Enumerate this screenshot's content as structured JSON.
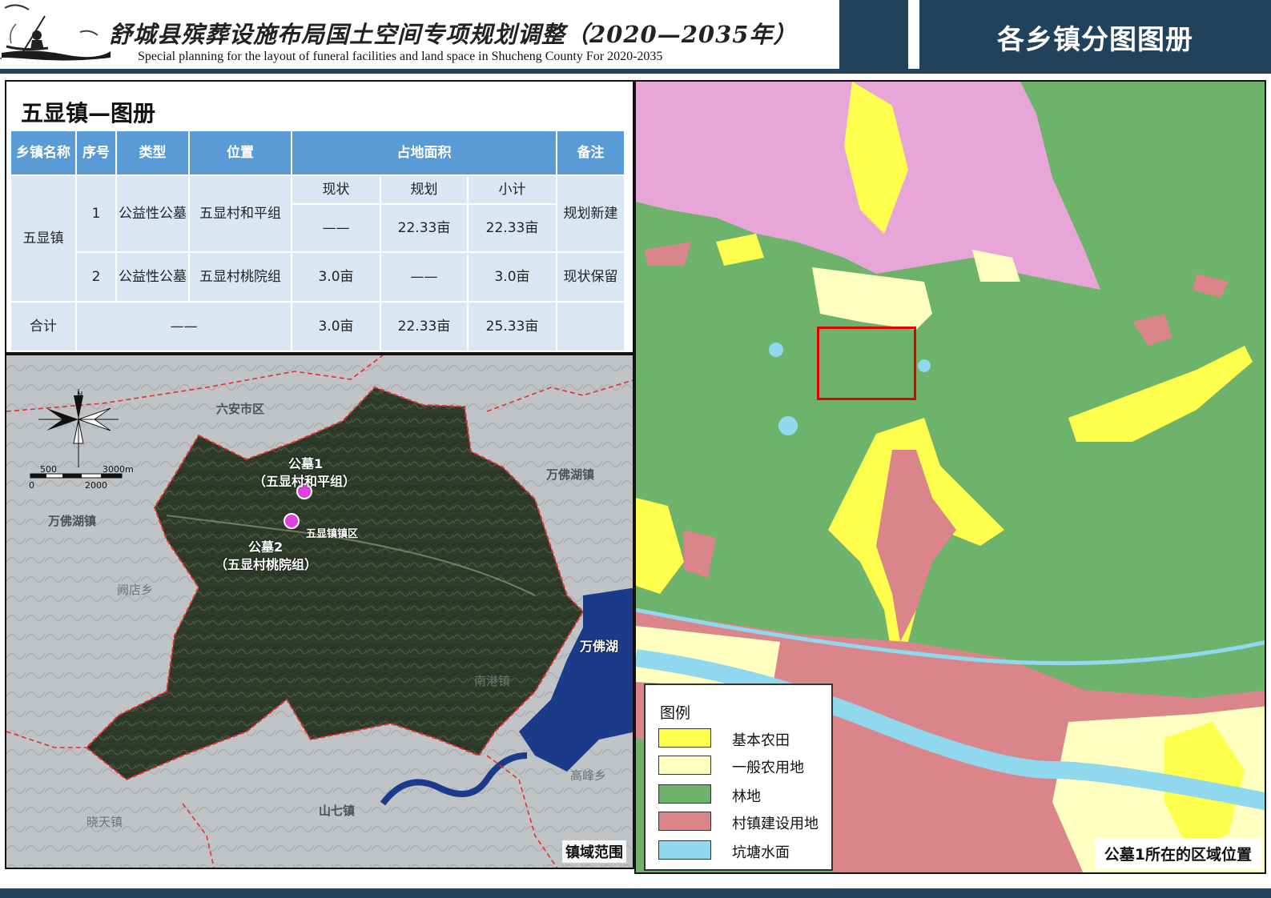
{
  "header": {
    "title_cn": "舒城县殡葬设施布局国土空间专项规划调整（2020—2035年）",
    "title_en": "Special planning for the layout of funeral facilities and land space in Shucheng County For 2020-2035",
    "right_title": "各乡镇分图图册"
  },
  "table_panel": {
    "title": "五显镇—图册",
    "headers": {
      "town": "乡镇名称",
      "seq": "序号",
      "type": "类型",
      "location": "位置",
      "area": "占地面积",
      "note": "备注",
      "current": "现状",
      "planned": "规划",
      "subtotal": "小计"
    },
    "town": "五显镇",
    "rows": [
      {
        "seq": "1",
        "type": "公益性公墓",
        "location": "五显村和平组",
        "current": "——",
        "planned": "22.33亩",
        "subtotal": "22.33亩",
        "note": "规划新建"
      },
      {
        "seq": "2",
        "type": "公益性公墓",
        "location": "五显村桃院组",
        "current": "3.0亩",
        "planned": "——",
        "subtotal": "3.0亩",
        "note": "现状保留"
      }
    ],
    "total": {
      "label": "合计",
      "mid": "——",
      "current": "3.0亩",
      "planned": "22.33亩",
      "subtotal": "25.33亩",
      "note": ""
    }
  },
  "town_map": {
    "caption": "镇域范围",
    "north": "N",
    "scale": {
      "s500": "500",
      "s3000": "3000m",
      "s0": "0",
      "s2000": "2000"
    },
    "neighbors": {
      "luan": "六安市区",
      "wanfohu_town_e": "万佛湖镇",
      "wanfohu_town_w": "万佛湖镇",
      "kandian": "阙店乡",
      "wanfohu_lake": "万佛湖",
      "nangang": "南港镇",
      "gaofeng": "高峰乡",
      "shanqi": "山七镇",
      "xiaotian": "晓天镇"
    },
    "cemetery1": {
      "name": "公墓1",
      "detail": "（五显村和平组）"
    },
    "cemetery2": {
      "name": "公墓2",
      "detail": "（五显村桃院组）"
    },
    "town_center": "五显镇镇区",
    "marker_color": "#e040e0"
  },
  "landuse_map": {
    "caption": "公墓1所在的区域位置",
    "legend_title": "图例",
    "legend": [
      {
        "label": "基本农田",
        "color": "#ffff4d"
      },
      {
        "label": "一般农用地",
        "color": "#ffffc0"
      },
      {
        "label": "林地",
        "color": "#6db36b"
      },
      {
        "label": "村镇建设用地",
        "color": "#d9858a"
      },
      {
        "label": "坑塘水面",
        "color": "#8fd8ee"
      }
    ],
    "locator_color": "#e00000"
  }
}
